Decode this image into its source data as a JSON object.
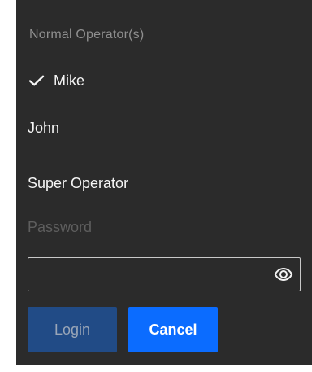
{
  "section": {
    "title": "Normal Operator(s)"
  },
  "operators": [
    {
      "label": "Mike",
      "checked": true
    },
    {
      "label": "John",
      "checked": false
    }
  ],
  "super_operator": {
    "label": "Super Operator"
  },
  "password": {
    "label": "Password",
    "value": "",
    "placeholder": ""
  },
  "icons": {
    "check": "check-icon",
    "visibility": "eye-icon"
  },
  "buttons": {
    "login": "Login",
    "cancel": "Cancel"
  },
  "colors": {
    "panel_background": "#2b2b2b",
    "login_disabled": "#214b86",
    "cancel_primary": "#0b6cff"
  }
}
